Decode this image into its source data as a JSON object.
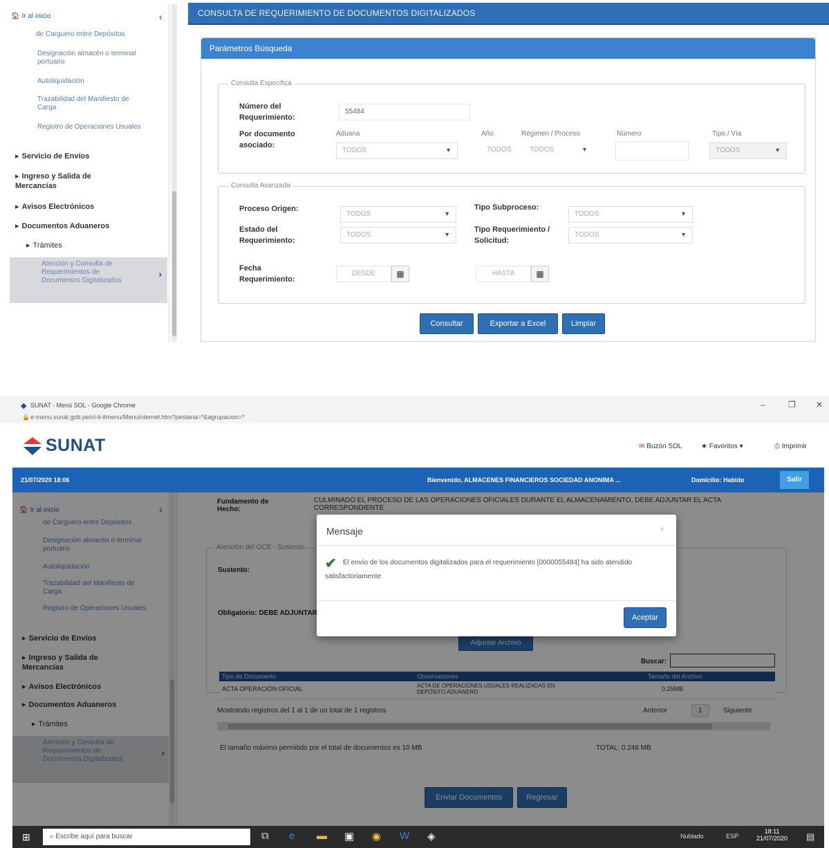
{
  "panel1": {
    "sidebar": {
      "home_label": "Ir al inicio",
      "collapse_glyph": "‹",
      "links": [
        "de Carguero entre Depósitos",
        "Designación almacén o terminal portuario",
        "Autoliquidación",
        "Trazabilidad del Manifiesto de Carga",
        "Registro de Operaciones Usuales"
      ],
      "sections": [
        "Servicio de Envíos",
        "Ingreso y Salida de Mercancías",
        "Avisos Electrónicos",
        "Documentos Aduaneros"
      ],
      "tramites": "Trámites",
      "selected": "Atención y Consulta de Requerimientos de Documentos Digitalizados"
    },
    "title": "CONSULTA DE REQUERIMIENTO DE DOCUMENTOS DIGITALIZADOS",
    "subtitle": "Parámetros Búsqueda",
    "especifica": {
      "legend": "Consulta Especifica",
      "numero_label": "Número del Requerimiento:",
      "numero_value": "55484",
      "doc_label": "Por documento asociado:",
      "aduana_label": "Aduana",
      "aduana_value": "TODOS",
      "anio_label": "Año",
      "anio_value": "TODOS",
      "regimen_label": "Régimen / Proceso",
      "regimen_value": "TODOS",
      "numero2_label": "Número",
      "tipo_label": "Tipo / Vía",
      "tipo_value": "TODOS"
    },
    "avanzada": {
      "legend": "Consulta Avanzada",
      "proceso_label": "Proceso Origen:",
      "proceso_value": "TODOS",
      "subproceso_label": "Tipo Subproceso:",
      "subproceso_value": "TODOS",
      "estado_label": "Estado del Requerimiento:",
      "estado_value": "TODOS",
      "tiporeq_label": "Tipo Requerimiento / Solicitud:",
      "tiporeq_value": "TODOS",
      "fecha_label": "Fecha Requerimiento:",
      "fecha_desde": "DESDE",
      "fecha_hasta": "HASTA"
    },
    "buttons": {
      "consultar": "Consultar",
      "exportar": "Exportar a Excel",
      "limpiar": "Limpiar"
    }
  },
  "panel2": {
    "browser": {
      "title": "SUNAT - Menú SOL - Google Chrome",
      "url": "e-menu.sunat.gob.pe/cl-ti-itmenu/MenuInternet.htm?pestana=*&agrupacion=*",
      "minimize": "–",
      "maximize": "❐",
      "close": "✕"
    },
    "header": {
      "logo": "SUNAT",
      "buzon": "Buzón SOL",
      "favoritos": "Favoritos",
      "imprimir": "Imprimir"
    },
    "userbar": {
      "datetime": "21/07/2020 18:06",
      "welcome": "Bienvenido, ALMACENES FINANCIEROS SOCIEDAD ANONIMA ...",
      "domicilio": "Domicilio: Habido",
      "salir": "Salir"
    },
    "sidebar": {
      "home_label": "Ir al inicio",
      "links": [
        "de Carguero entre Depósitos",
        "Designación almacén o terminal portuario",
        "Autoliquidación",
        "Trazabilidad del Manifiesto de Carga",
        "Registro de Operaciones Usuales"
      ],
      "sections": [
        "Servicio de Envíos",
        "Ingreso y Salida de Mercancías",
        "Avisos Electrónicos",
        "Documentos Aduaneros"
      ],
      "tramites": "Trámites",
      "selected": "Atención y Consulta de Requerimientos de Documentos Digitalizados"
    },
    "background": {
      "fundamento_label": "Fundamento de Hecho:",
      "fundamento_value": "CULMINADO EL PROCESO DE LAS OPERACIONES OFICIALES DURANTE EL ALMACENAMIENTO, DEBE ADJUNTAR EL ACTA CORRESPONDIENTE",
      "atencion_legend": "Atención del OCE - Sustento",
      "sustento_label": "Sustento:",
      "obligatorio_label": "Obligatorio: DEBE ADJUNTAR",
      "adjuntar_btn": "Adjuntar Archivo",
      "buscar_label": "Buscar:",
      "table_headers": [
        "Tipo de Documento",
        "Observaciones",
        "Tamaño del Archivo"
      ],
      "row": [
        "ACTA OPERACIÓN OFICIAL",
        "ACTA DE OPERACIONES USUALES REALIZADAS EN DEPÓSITO ADUANERO",
        "0.25MB"
      ],
      "pagination": "Mostrando registros del 1 al 1 de un total de 1 registros",
      "anterior": "Anterior",
      "page": "1",
      "siguiente": "Siguiente",
      "limit_note": "El tamaño máximo permitido por el total de documentos es 10 MB",
      "total": "TOTAL: 0.246 MB",
      "enviar_btn": "Enviar Documentos",
      "regresar_btn": "Regresar"
    },
    "modal": {
      "title": "Mensaje",
      "close": "×",
      "message": "El envío de los documentos digitalizados para el requerimiento [0000055484] ha sido atendido satisfactoriamente",
      "accept": "Aceptar"
    },
    "taskbar": {
      "search_placeholder": "Escribe aquí para buscar",
      "weather": "Nublado",
      "lang": "ESP",
      "time": "18:11",
      "date": "21/07/2020"
    }
  }
}
